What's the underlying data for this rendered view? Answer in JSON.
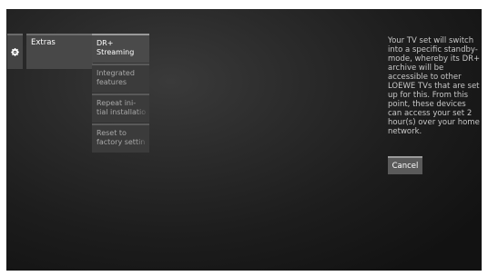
{
  "nav": {
    "settings_icon": "gear-icon",
    "extras_label": "Extras"
  },
  "menu": {
    "items": [
      {
        "line1": "DR+",
        "line2": "Streaming",
        "selected": true
      },
      {
        "line1": "Integrated",
        "line2": "features",
        "selected": false
      },
      {
        "line1": "Repeat ini-",
        "line2": "tial installatio",
        "selected": false
      },
      {
        "line1": "Reset to",
        "line2": "factory settin",
        "selected": false
      }
    ]
  },
  "info": {
    "text": "Your TV set will switch into a specific standby-mode, whereby its DR+ archive will be accessible to other LOEWE TVs that are set up for this. From this point, these devices can access your set 2 hour(s) over your home network."
  },
  "actions": {
    "cancel_label": "Cancel"
  }
}
